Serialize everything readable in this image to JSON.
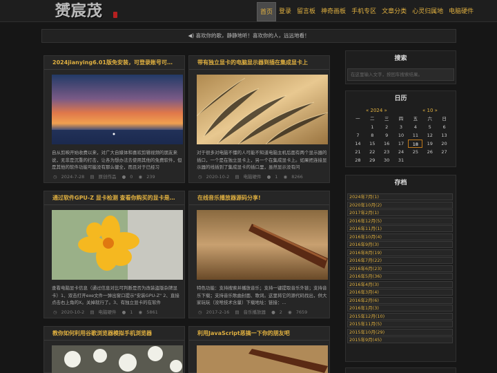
{
  "site": {
    "logo_text": "赟宸茂"
  },
  "nav": [
    "首页",
    "登录",
    "留言板",
    "神奇画板",
    "手机专区",
    "文章分类",
    "心灵归属地",
    "电脑硬件"
  ],
  "notice": "◀) 喜欢你的歌，静静地听！喜欢你的人，远远地看！",
  "posts": [
    {
      "title": "2024jianying6.01版免安装，可登录账号可用任何功能",
      "excerpt": "自从剪映开始收费以来，对广大自媒体和喜欢剪辑视频的朋友来说，无非是沉重的打击，让各为想办法去使用其他的免费软件，但是其他的软件功能可能没有那么健全，而且对于已经习",
      "date": "2024-7-28",
      "category": "原创作品",
      "comments": "0",
      "views": "239"
    },
    {
      "title": "带有独立显卡的电脑显示器到插在集成显卡上",
      "excerpt": "对于很多对电脑不懂的人可能不知道电脑主机后面有两个显示器的插口，一个是在独立显卡上，另一个在集成显卡上。如果把连接显示器的线插到了集成显卡的插口里，虽然显示没有问",
      "date": "2020-10-2",
      "category": "电脑硬件",
      "comments": "1",
      "views": "8266"
    },
    {
      "title": "通过软件GPU-Z 显卡检测 查看你购买的显卡是否为真",
      "excerpt": "查看电脑显卡信息（通过信息对比可判断是否为改装盗版杂牌显卡）1、双击打开exe文件一弹出窗口提示\"安装GPU-Z\" 2、直接点击右上角的X。关掉就行了。3、有独立显卡的在软件",
      "date": "2020-10-2",
      "category": "电脑硬件",
      "comments": "1",
      "views": "5861"
    },
    {
      "title": "在线音乐播放器源码分享!",
      "excerpt": "特色功能：支持搜索并播放音乐；支持一键提取音乐外链；支持音乐下载；支持音乐歌曲封面、歌词。这里将它的源代码找出，供大家玩玩（没啥技术含量）下载地址：链接：...",
      "date": "2017-2-16",
      "category": "音乐播放器",
      "comments": "2",
      "views": "7659"
    },
    {
      "title": "教你如何利用谷歌浏览器模拟手机浏览器"
    },
    {
      "title": "利用JavaScript恶搞一下你的朋友吧"
    }
  ],
  "sidebar": {
    "search_title": "搜索",
    "search_placeholder": "在这里输入文字，按回车搜索结果。",
    "calendar_title": "日历",
    "cal_year": "« 2024 »",
    "cal_month": "« 10 »",
    "weekdays": [
      "一",
      "二",
      "三",
      "四",
      "五",
      "六",
      "日"
    ],
    "days": [
      "",
      "1",
      "2",
      "3",
      "4",
      "5",
      "6",
      "7",
      "8",
      "9",
      "10",
      "11",
      "12",
      "13",
      "14",
      "15",
      "16",
      "17",
      "18",
      "19",
      "20",
      "21",
      "22",
      "23",
      "24",
      "25",
      "26",
      "27",
      "28",
      "29",
      "30",
      "31",
      "",
      "",
      ""
    ],
    "today": "18",
    "archive_title": "存档",
    "archives": [
      "2024年7月(1)",
      "2020年10月(2)",
      "2017年2月(1)",
      "2016年12月(5)",
      "2016年11月(1)",
      "2016年10月(4)",
      "2016年9月(3)",
      "2016年8月(19)",
      "2016年7月(22)",
      "2016年6月(23)",
      "2016年5月(36)",
      "2016年4月(3)",
      "2016年3月(4)",
      "2016年2月(6)",
      "2016年1月(3)",
      "2015年12月(10)",
      "2015年11月(5)",
      "2015年10月(29)",
      "2015年9月(45)"
    ]
  },
  "colors": {
    "accent": "#e0b040",
    "background": "#161616",
    "card": "#262626"
  }
}
